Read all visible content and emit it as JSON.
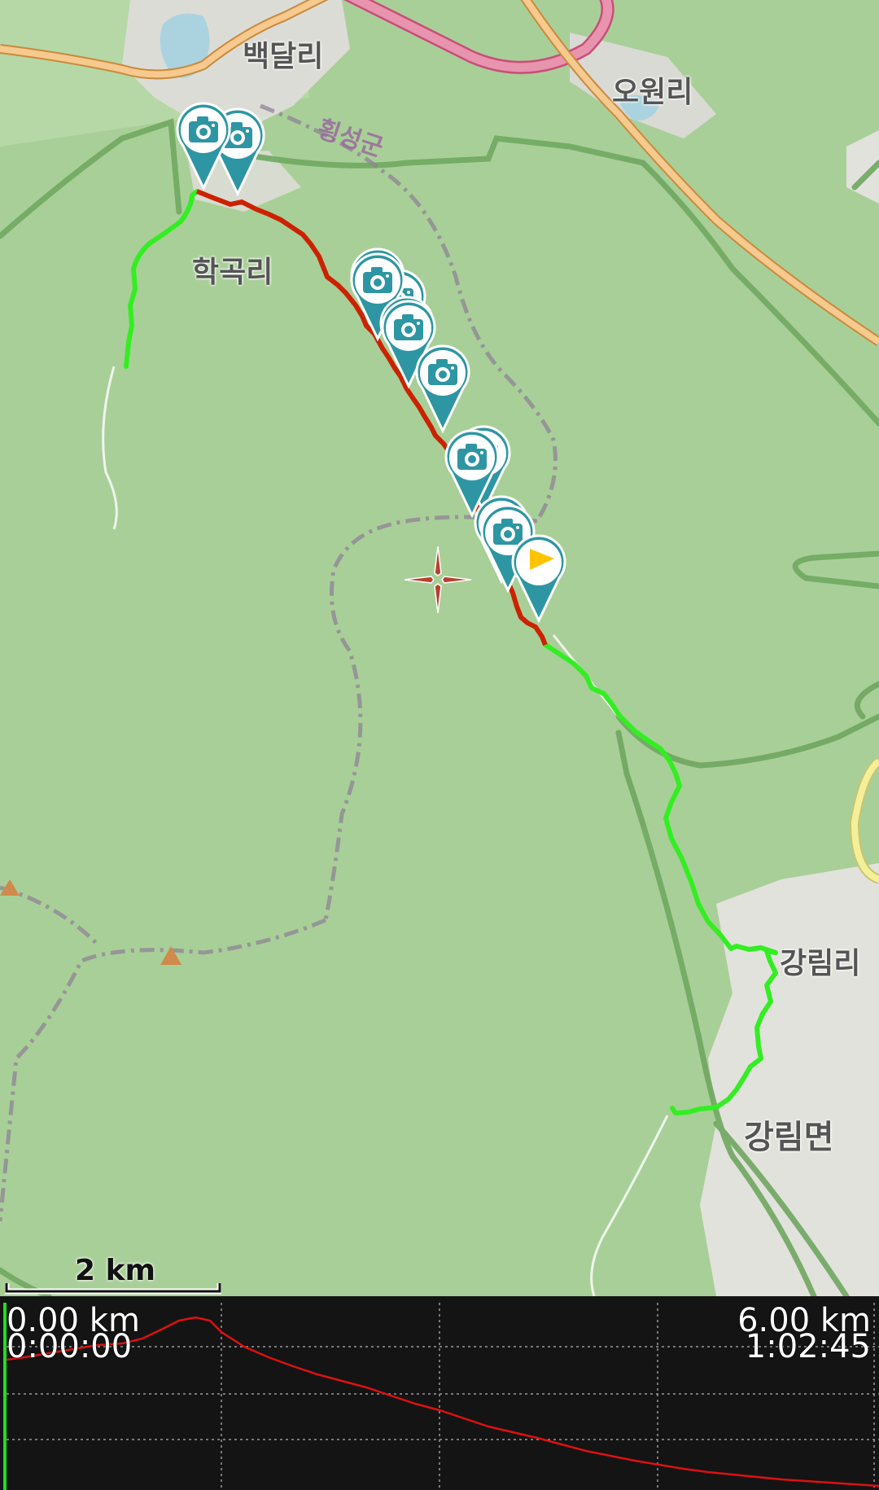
{
  "map": {
    "places": {
      "baekdal": "백달리",
      "owon": "오원리",
      "hakgok": "학곡리",
      "gangnim_ri": "강림리",
      "gangnim_myeon": "강림면"
    },
    "county_label": "횡성군",
    "icons": {
      "photo_marker": "camera-marker-icon",
      "waypoint_flag": "flag-marker-icon",
      "crosshair": "crosshair-icon",
      "peak": "peak-triangle-icon"
    },
    "colors": {
      "recorded_track": "#cc2200",
      "planned_route": "#33ee22",
      "marker": "#2e96a3",
      "flag": "#ffc400",
      "background": "#a9cf98"
    }
  },
  "scale_bar": {
    "label": "2 km"
  },
  "profile": {
    "start_distance": "0.00 km",
    "start_time": "0:00:00",
    "end_distance": "6.00 km",
    "end_time": "1:02:45",
    "line_color": "#dd1111",
    "cursor_color": "#22dd22"
  }
}
